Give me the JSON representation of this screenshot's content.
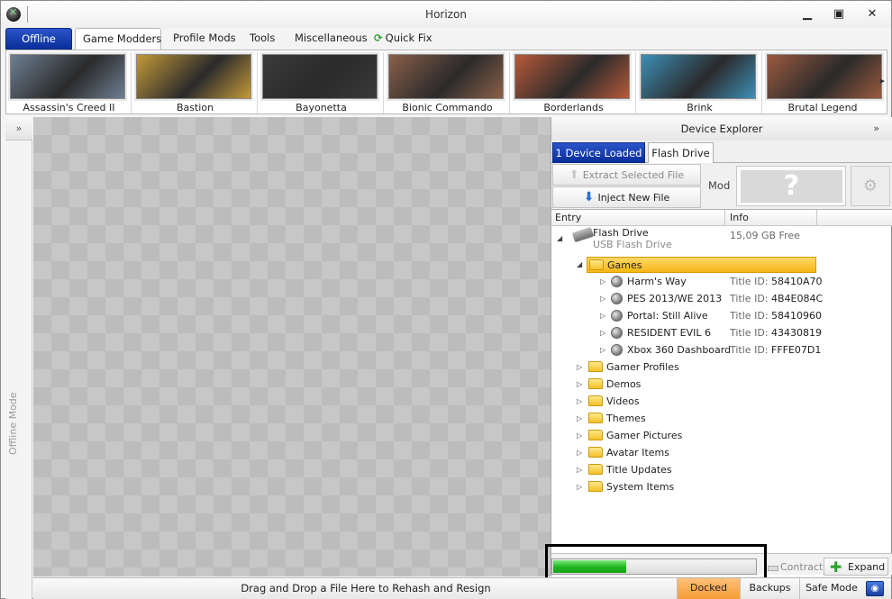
{
  "window": {
    "title": "Horizon"
  },
  "tabs": [
    {
      "label": "Offline"
    },
    {
      "label": "Game Modders"
    },
    {
      "label": "Profile Mods"
    },
    {
      "label": "Tools"
    },
    {
      "label": "Miscellaneous"
    },
    {
      "label": "Quick Fix"
    }
  ],
  "games": [
    {
      "name": "Assassin's Creed II",
      "color": "#6e7f92"
    },
    {
      "name": "Bastion",
      "color": "#c49a3a"
    },
    {
      "name": "Bayonetta",
      "color": "#3a3a3a"
    },
    {
      "name": "Bionic Commando",
      "color": "#8a6048"
    },
    {
      "name": "Borderlands",
      "color": "#b85a3a"
    },
    {
      "name": "Brink",
      "color": "#3e8fb6"
    },
    {
      "name": "Brutal Legend",
      "color": "#9a5a3e"
    }
  ],
  "left_panel": {
    "label": "Offline Mode"
  },
  "explorer": {
    "title": "Device Explorer",
    "tabs": [
      {
        "label": "1 Device Loaded"
      },
      {
        "label": "Flash Drive"
      }
    ],
    "extract_label": "Extract Selected File",
    "inject_label": "Inject New File",
    "mod_label": "Mod",
    "mod_placeholder": "?",
    "columns": [
      "Entry",
      "Info"
    ],
    "device": {
      "name": "Flash Drive",
      "type": "USB Flash Drive",
      "free": "15,09 GB Free"
    },
    "games_folder": "Games",
    "title_id_label": "Title ID:",
    "titles": [
      {
        "name": "Harm's Way",
        "id": "58410A70"
      },
      {
        "name": "PES 2013/WE 2013",
        "id": "4B4E084C"
      },
      {
        "name": "Portal: Still Alive",
        "id": "58410960"
      },
      {
        "name": "RESIDENT EVIL 6",
        "id": "43430819"
      },
      {
        "name": "Xbox 360 Dashboard",
        "id": "FFFE07D1"
      }
    ],
    "folders": [
      "Gamer Profiles",
      "Demos",
      "Videos",
      "Themes",
      "Gamer Pictures",
      "Avatar Items",
      "Title Updates",
      "System Items"
    ],
    "contract_label": "Contract",
    "expand_label": "Expand",
    "progress": 0.36
  },
  "status": {
    "drop_text": "Drag and Drop a File Here to Rehash and Resign",
    "docked_label": "Docked",
    "backups_label": "Backups",
    "safe_mode_label": "Safe Mode"
  },
  "colors": {
    "accent_blue": "#0b2f9a",
    "selection": "#f5b618",
    "progress_green": "#1fb51f",
    "docked_orange": "#f59c36"
  }
}
